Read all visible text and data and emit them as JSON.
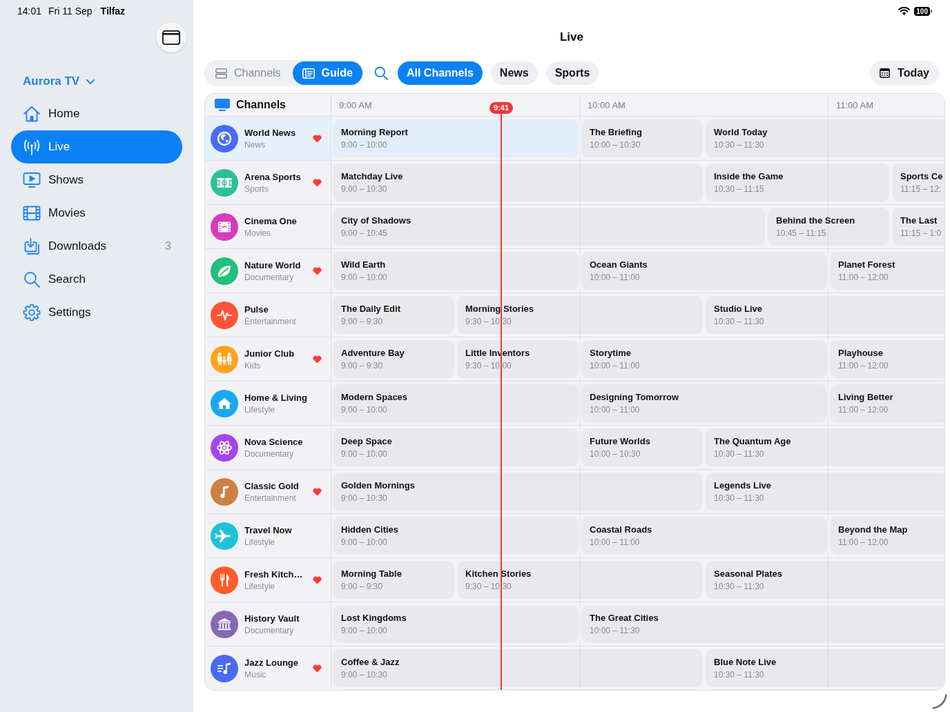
{
  "status_bar": {
    "time": "14:01",
    "date": "Fri 11 Sep",
    "carrier": "Tilfaz",
    "battery": "100"
  },
  "sidebar": {
    "account": "Aurora TV",
    "items": [
      {
        "label": "Home",
        "kind": "house",
        "selected": false
      },
      {
        "label": "Live",
        "kind": "antenna",
        "selected": true
      },
      {
        "label": "Shows",
        "kind": "tv",
        "selected": false
      },
      {
        "label": "Movies",
        "kind": "film",
        "selected": false
      },
      {
        "label": "Downloads",
        "kind": "download",
        "selected": false,
        "badge": "3"
      },
      {
        "label": "Search",
        "kind": "search",
        "selected": false
      },
      {
        "label": "Settings",
        "kind": "gear",
        "selected": false
      }
    ]
  },
  "title": "Live",
  "toolbar": {
    "views": [
      {
        "label": "Channels",
        "kind": "list",
        "selected": false
      },
      {
        "label": "Guide",
        "kind": "guide",
        "selected": true
      }
    ],
    "filters": [
      {
        "label": "All Channels",
        "selected": true
      },
      {
        "label": "News",
        "selected": false
      },
      {
        "label": "Sports",
        "selected": false
      }
    ],
    "date_button": "Today"
  },
  "guide": {
    "channels_header": "Channels",
    "hours": [
      "9:00 AM",
      "10:00 AM",
      "11:00 AM"
    ],
    "now": "9:41",
    "channels": [
      {
        "name": "World News",
        "genre": "News",
        "kind": "globe",
        "color": "#4a6cf5",
        "favorite": true,
        "selected": true,
        "programs": [
          {
            "title": "Morning Report",
            "time": "9:00 – 10:00",
            "selected": true
          },
          {
            "title": "The Briefing",
            "time": "10:00 – 10:30",
            "selected": false
          },
          {
            "title": "World Today",
            "time": "10:30 – 11:30",
            "selected": false
          }
        ]
      },
      {
        "name": "Arena Sports",
        "genre": "Sports",
        "kind": "field",
        "color": "#2bc196",
        "favorite": true,
        "selected": false,
        "programs": [
          {
            "title": "Matchday Live",
            "time": "9:00 – 10:30",
            "selected": false
          },
          {
            "title": "Inside the Game",
            "time": "10:30 – 11:15",
            "selected": false
          },
          {
            "title": "Sports Ce",
            "time": "11:15 – 12:",
            "selected": false
          }
        ]
      },
      {
        "name": "Cinema One",
        "genre": "Movies",
        "kind": "film",
        "color": "#d63cc0",
        "favorite": false,
        "selected": false,
        "programs": [
          {
            "title": "City of Shadows",
            "time": "9:00 – 10:45",
            "selected": false
          },
          {
            "title": "Behind the Screen",
            "time": "10:45 – 11:15",
            "selected": false
          },
          {
            "title": "The Last",
            "time": "11:15 – 1:0",
            "selected": false
          }
        ]
      },
      {
        "name": "Nature World",
        "genre": "Documentary",
        "kind": "leaf",
        "color": "#23bf7d",
        "favorite": true,
        "selected": false,
        "programs": [
          {
            "title": "Wild Earth",
            "time": "9:00 – 10:00",
            "selected": false
          },
          {
            "title": "Ocean Giants",
            "time": "10:00 – 11:00",
            "selected": false
          },
          {
            "title": "Planet Forest",
            "time": "11:00 – 12:00",
            "selected": false
          }
        ]
      },
      {
        "name": "Pulse",
        "genre": "Entertainment",
        "kind": "pulse",
        "color": "#ff5436",
        "favorite": false,
        "selected": false,
        "programs": [
          {
            "title": "The Daily Edit",
            "time": "9:00 – 9:30",
            "selected": false
          },
          {
            "title": "Morning Stories",
            "time": "9:30 – 10:30",
            "selected": false
          },
          {
            "title": "Studio Live",
            "time": "10:30 – 11:30",
            "selected": false
          }
        ]
      },
      {
        "name": "Junior Club",
        "genre": "Kids",
        "kind": "family",
        "color": "#ffa21f",
        "favorite": true,
        "selected": false,
        "programs": [
          {
            "title": "Adventure Bay",
            "time": "9:00 – 9:30",
            "selected": false
          },
          {
            "title": "Little Inventors",
            "time": "9:30 – 10:00",
            "selected": false
          },
          {
            "title": "Storytime",
            "time": "10:00 – 11:00",
            "selected": false
          },
          {
            "title": "Playhouse",
            "time": "11:00 – 12:00",
            "selected": false
          }
        ]
      },
      {
        "name": "Home & Living",
        "genre": "Lifestyle",
        "kind": "house",
        "color": "#18a8f2",
        "favorite": false,
        "selected": false,
        "programs": [
          {
            "title": "Modern Spaces",
            "time": "9:00 – 10:00",
            "selected": false
          },
          {
            "title": "Designing Tomorrow",
            "time": "10:00 – 11:00",
            "selected": false
          },
          {
            "title": "Living Better",
            "time": "11:00 – 12:00",
            "selected": false
          }
        ]
      },
      {
        "name": "Nova Science",
        "genre": "Documentary",
        "kind": "atom",
        "color": "#a544ea",
        "favorite": false,
        "selected": false,
        "programs": [
          {
            "title": "Deep Space",
            "time": "9:00 – 10:00",
            "selected": false
          },
          {
            "title": "Future Worlds",
            "time": "10:00 – 10:30",
            "selected": false
          },
          {
            "title": "The Quantum Age",
            "time": "10:30 – 11:30",
            "selected": false
          }
        ]
      },
      {
        "name": "Classic Gold",
        "genre": "Entertainment",
        "kind": "note",
        "color": "#cd8142",
        "favorite": true,
        "selected": false,
        "programs": [
          {
            "title": "Golden Mornings",
            "time": "9:00 – 10:30",
            "selected": false
          },
          {
            "title": "Legends Live",
            "time": "10:30 – 11:30",
            "selected": false
          }
        ]
      },
      {
        "name": "Travel Now",
        "genre": "Lifestyle",
        "kind": "plane",
        "color": "#1ec3d8",
        "favorite": false,
        "selected": false,
        "programs": [
          {
            "title": "Hidden Cities",
            "time": "9:00 – 10:00",
            "selected": false
          },
          {
            "title": "Coastal Roads",
            "time": "10:00 – 11:00",
            "selected": false
          },
          {
            "title": "Beyond the Map",
            "time": "11:00 – 12:00",
            "selected": false
          }
        ]
      },
      {
        "name": "Fresh Kitch…",
        "genre": "Lifestyle",
        "kind": "utensils",
        "color": "#ff5c2b",
        "favorite": true,
        "selected": false,
        "programs": [
          {
            "title": "Morning Table",
            "time": "9:00 – 9:30",
            "selected": false
          },
          {
            "title": "Kitchen Stories",
            "time": "9:30 – 10:30",
            "selected": false
          },
          {
            "title": "Seasonal Plates",
            "time": "10:30 – 11:30",
            "selected": false
          }
        ]
      },
      {
        "name": "History Vault",
        "genre": "Documentary",
        "kind": "columns",
        "color": "#8768b4",
        "favorite": false,
        "selected": false,
        "programs": [
          {
            "title": "Lost Kingdoms",
            "time": "9:00 – 10:00",
            "selected": false
          },
          {
            "title": "The Great Cities",
            "time": "10:00 – 11:30",
            "selected": false
          }
        ]
      },
      {
        "name": "Jazz Lounge",
        "genre": "Music",
        "kind": "playlist",
        "color": "#4a6af0",
        "favorite": true,
        "selected": false,
        "programs": [
          {
            "title": "Coffee & Jazz",
            "time": "9:00 – 10:30",
            "selected": false
          },
          {
            "title": "Blue Note Live",
            "time": "10:30 – 11:30",
            "selected": false
          }
        ]
      }
    ]
  }
}
